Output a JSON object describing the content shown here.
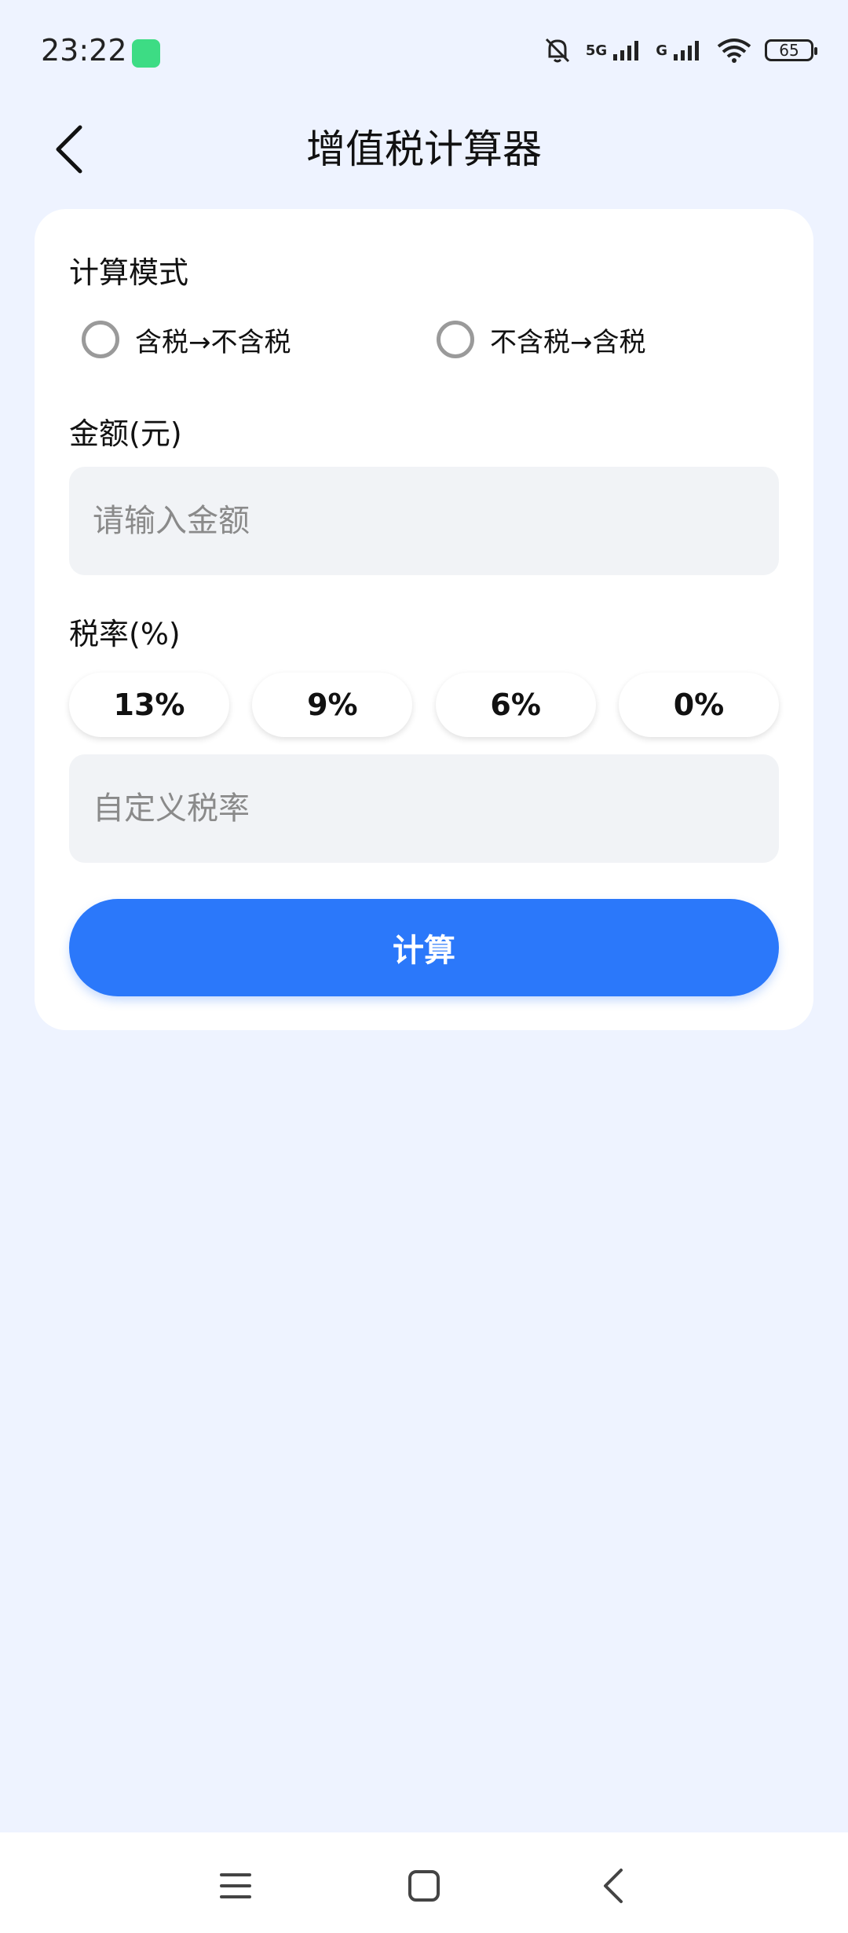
{
  "status_bar": {
    "time": "23:22",
    "network_5g": "5G",
    "network_g": "G",
    "battery": "65"
  },
  "header": {
    "title": "增值税计算器"
  },
  "form": {
    "mode_label": "计算模式",
    "mode_options": [
      "含税→不含税",
      "不含税→含税"
    ],
    "amount_label": "金额(元)",
    "amount_placeholder": "请输入金额",
    "rate_label": "税率(%)",
    "rate_options": [
      "13%",
      "9%",
      "6%",
      "0%"
    ],
    "custom_rate_placeholder": "自定义税率",
    "calculate_label": "计算"
  },
  "colors": {
    "background": "#EEF3FF",
    "primary": "#2B78FA"
  }
}
